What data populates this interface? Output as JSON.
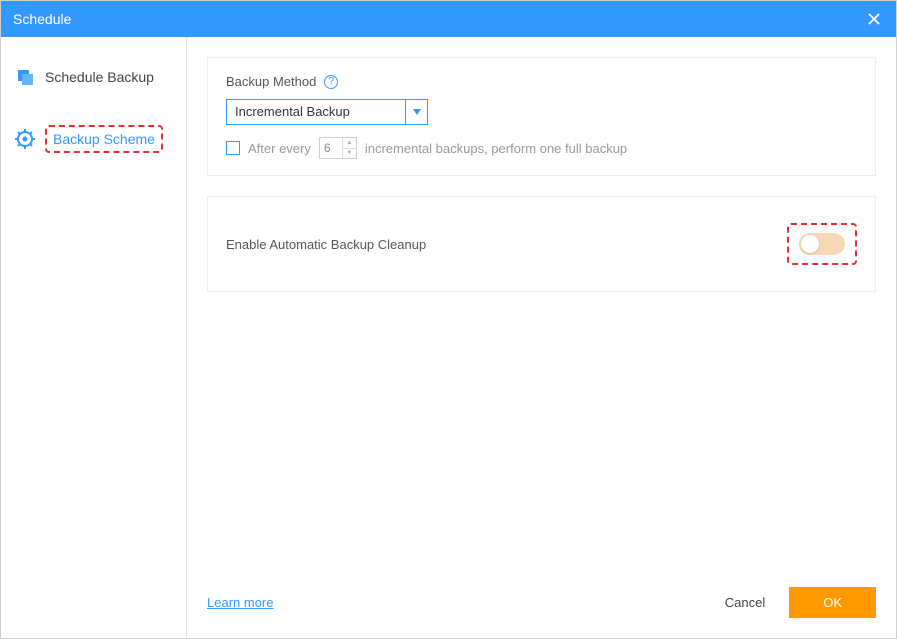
{
  "titlebar": {
    "title": "Schedule"
  },
  "sidebar": {
    "items": [
      {
        "label": "Schedule Backup",
        "icon": "overlap-square-icon",
        "selected": false
      },
      {
        "label": "Backup Scheme",
        "icon": "gear-icon",
        "selected": true
      }
    ]
  },
  "method_panel": {
    "label": "Backup Method",
    "dropdown_value": "Incremental Backup",
    "after_every_label_pre": "After every",
    "after_every_value": "6",
    "after_every_label_post": "incremental backups, perform one full backup",
    "after_every_checked": false
  },
  "cleanup_panel": {
    "label": "Enable Automatic Backup Cleanup",
    "toggle_on": false
  },
  "footer": {
    "learn_more": "Learn more",
    "cancel": "Cancel",
    "ok": "OK"
  }
}
